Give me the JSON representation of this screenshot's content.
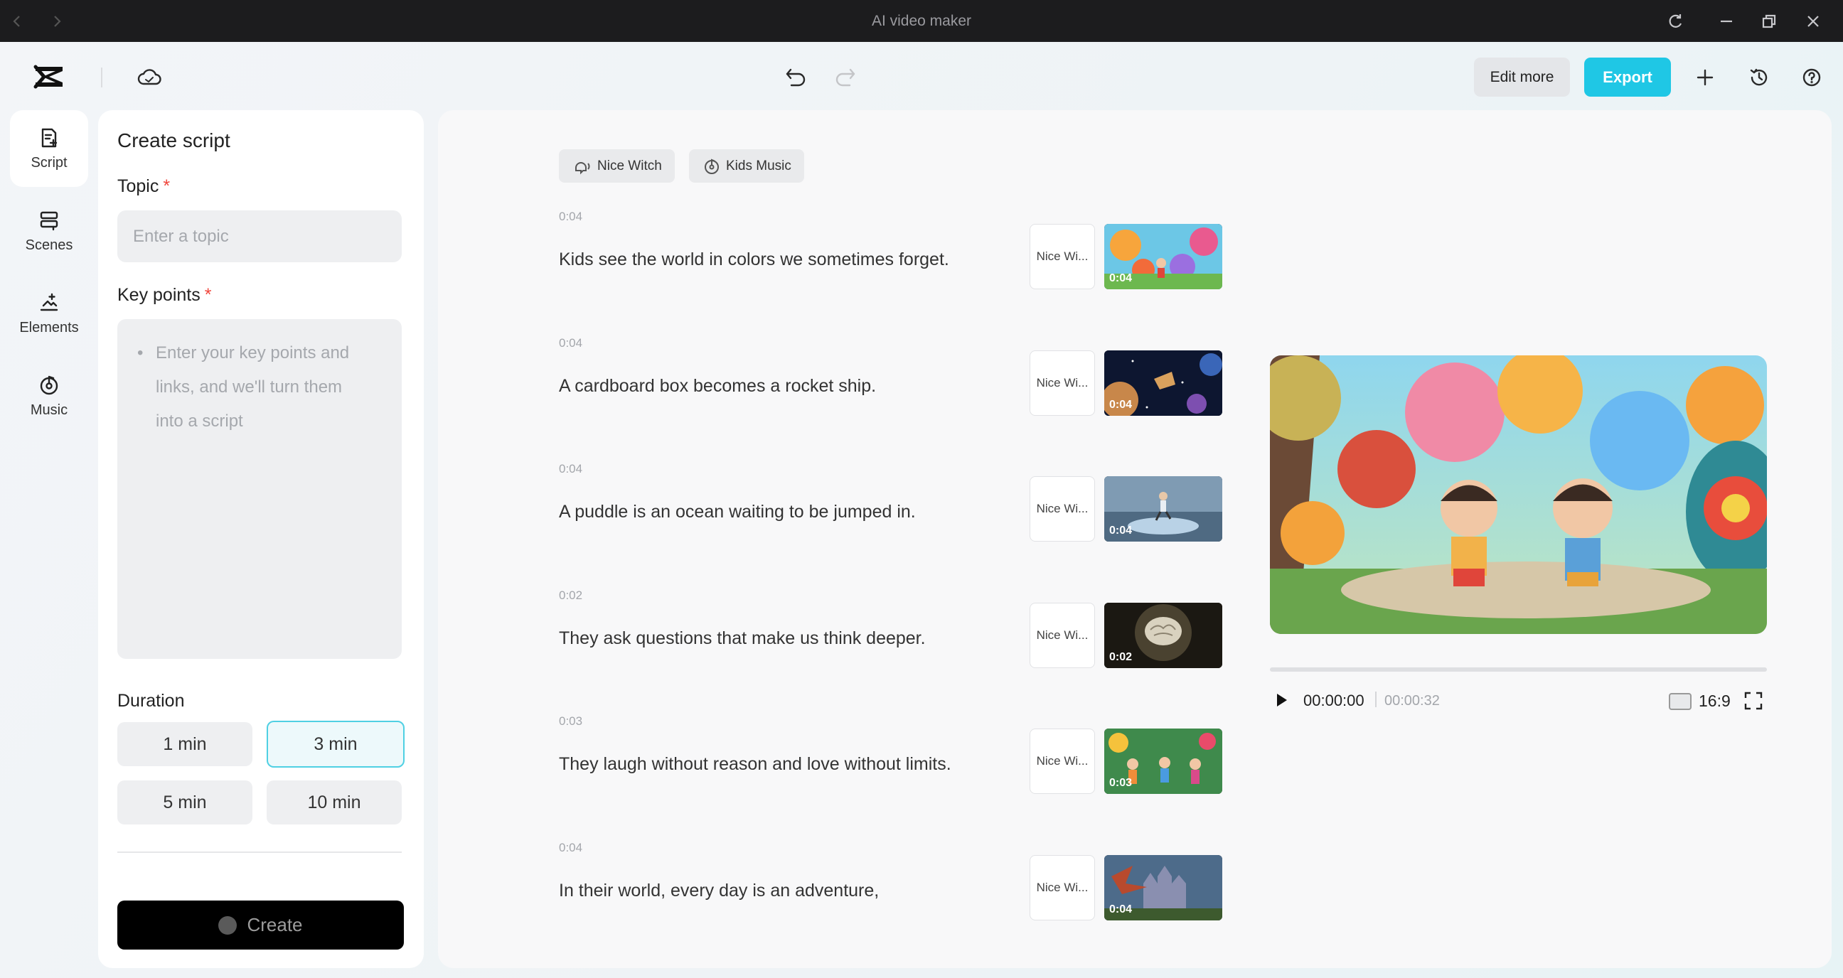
{
  "window": {
    "title": "AI video maker"
  },
  "toolbar": {
    "edit_more_label": "Edit more",
    "export_label": "Export"
  },
  "nav": {
    "items": [
      {
        "label": "Script",
        "icon": "script-icon",
        "active": true
      },
      {
        "label": "Scenes",
        "icon": "scenes-icon"
      },
      {
        "label": "Elements",
        "icon": "elements-icon"
      },
      {
        "label": "Music",
        "icon": "music-icon"
      }
    ]
  },
  "script_panel": {
    "title": "Create script",
    "topic_label": "Topic",
    "required_mark": "*",
    "topic_placeholder": "Enter a topic",
    "topic_value": "",
    "keypoints_label": "Key points",
    "keypoints_bullet": "•",
    "keypoints_placeholder": "Enter your key points and links, and we'll turn them into a script",
    "keypoints_lines": [
      "Enter your key points and",
      "links, and we'll turn them",
      "into a script"
    ],
    "duration_label": "Duration",
    "durations": [
      {
        "label": "1 min",
        "selected": false
      },
      {
        "label": "3 min",
        "selected": true
      },
      {
        "label": "5 min",
        "selected": false
      },
      {
        "label": "10 min",
        "selected": false
      }
    ],
    "create_label": "Create"
  },
  "main": {
    "chips": [
      {
        "label": "Nice Witch",
        "icon": "voice-icon"
      },
      {
        "label": "Kids Music",
        "icon": "music-icon"
      }
    ],
    "scenes": [
      {
        "duration": "0:04",
        "text": "Kids see the world in colors we sometimes forget.",
        "voice": "Nice Wi...",
        "thumb_time": "0:04"
      },
      {
        "duration": "0:04",
        "text": "A cardboard box becomes a rocket ship.",
        "voice": "Nice Wi...",
        "thumb_time": "0:04"
      },
      {
        "duration": "0:04",
        "text": "A puddle is an ocean waiting to be jumped in.",
        "voice": "Nice Wi...",
        "thumb_time": "0:04"
      },
      {
        "duration": "0:02",
        "text": "They ask questions that make us think deeper.",
        "voice": "Nice Wi...",
        "thumb_time": "0:02"
      },
      {
        "duration": "0:03",
        "text": "They laugh without reason and love without limits.",
        "voice": "Nice Wi...",
        "thumb_time": "0:03"
      },
      {
        "duration": "0:04",
        "text": "In their world, every day is an adventure,",
        "voice": "Nice Wi...",
        "thumb_time": "0:04"
      }
    ]
  },
  "preview": {
    "current_time": "00:00:00",
    "total_time": "00:00:32",
    "progress_fraction": 0,
    "aspect_ratio": "16:9"
  },
  "colors": {
    "accent": "#1fc7e5",
    "titlebar": "#1c1c1e",
    "required": "#f0463c"
  }
}
